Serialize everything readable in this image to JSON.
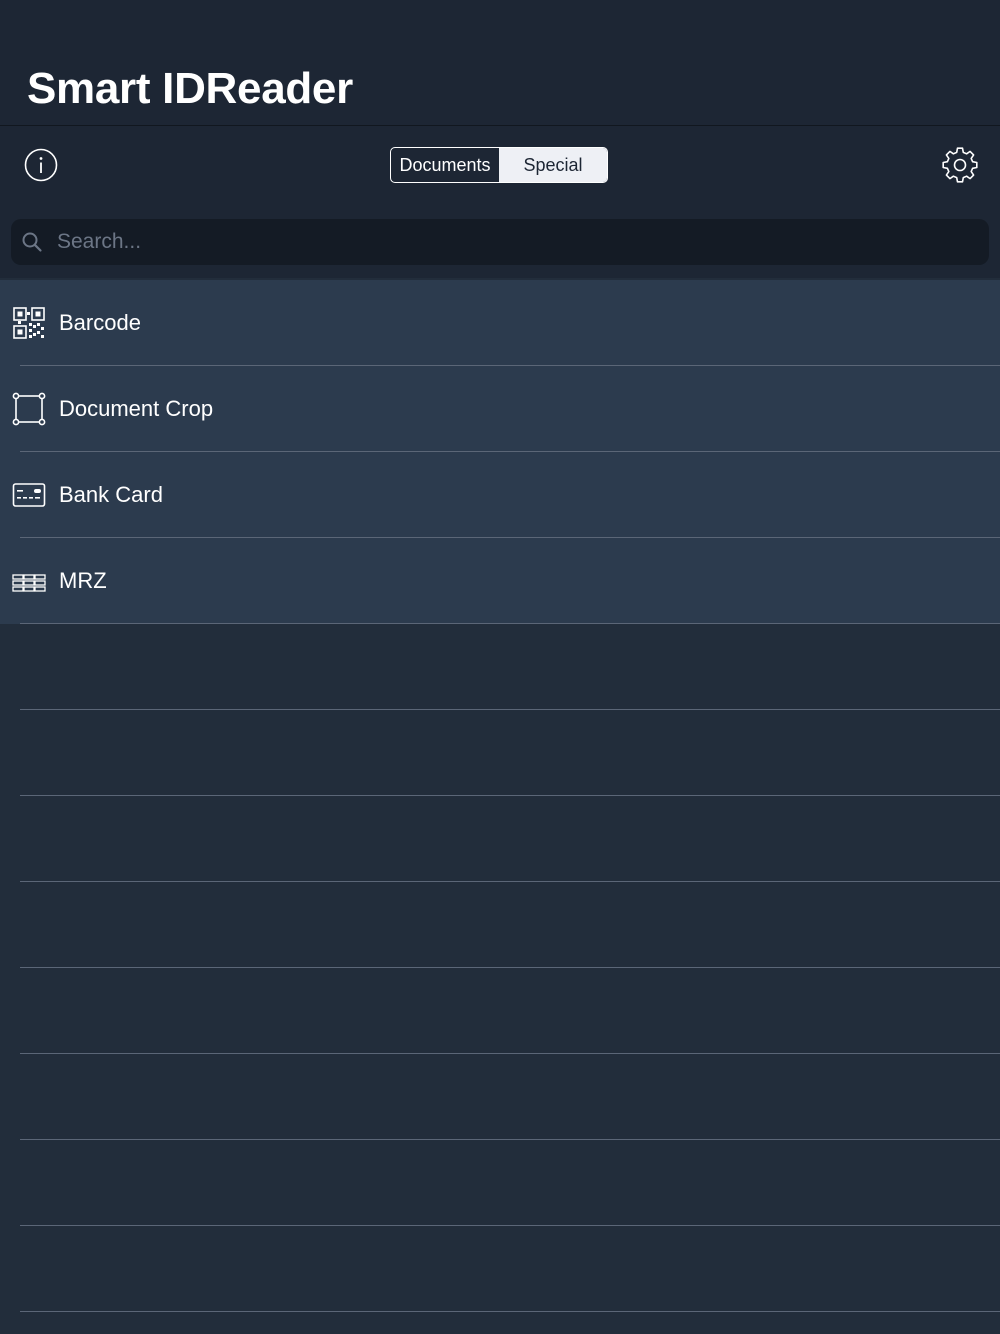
{
  "header": {
    "title": "Smart IDReader"
  },
  "toolbar": {
    "info_icon": "info-circle-icon",
    "settings_icon": "gear-icon",
    "segments": [
      {
        "label": "Documents",
        "selected": false
      },
      {
        "label": "Special",
        "selected": true
      }
    ]
  },
  "search": {
    "placeholder": "Search...",
    "value": ""
  },
  "list": {
    "items": [
      {
        "label": "Barcode",
        "icon": "qr-code-icon"
      },
      {
        "label": "Document Crop",
        "icon": "crop-frame-icon"
      },
      {
        "label": "Bank Card",
        "icon": "bank-card-icon"
      },
      {
        "label": "MRZ",
        "icon": "mrz-icon"
      }
    ]
  },
  "colors": {
    "nav_background": "#1d2634",
    "page_background": "#222d3b",
    "row_background": "#2c3b4e",
    "separator": "#5b6677",
    "search_background": "#141b25"
  }
}
